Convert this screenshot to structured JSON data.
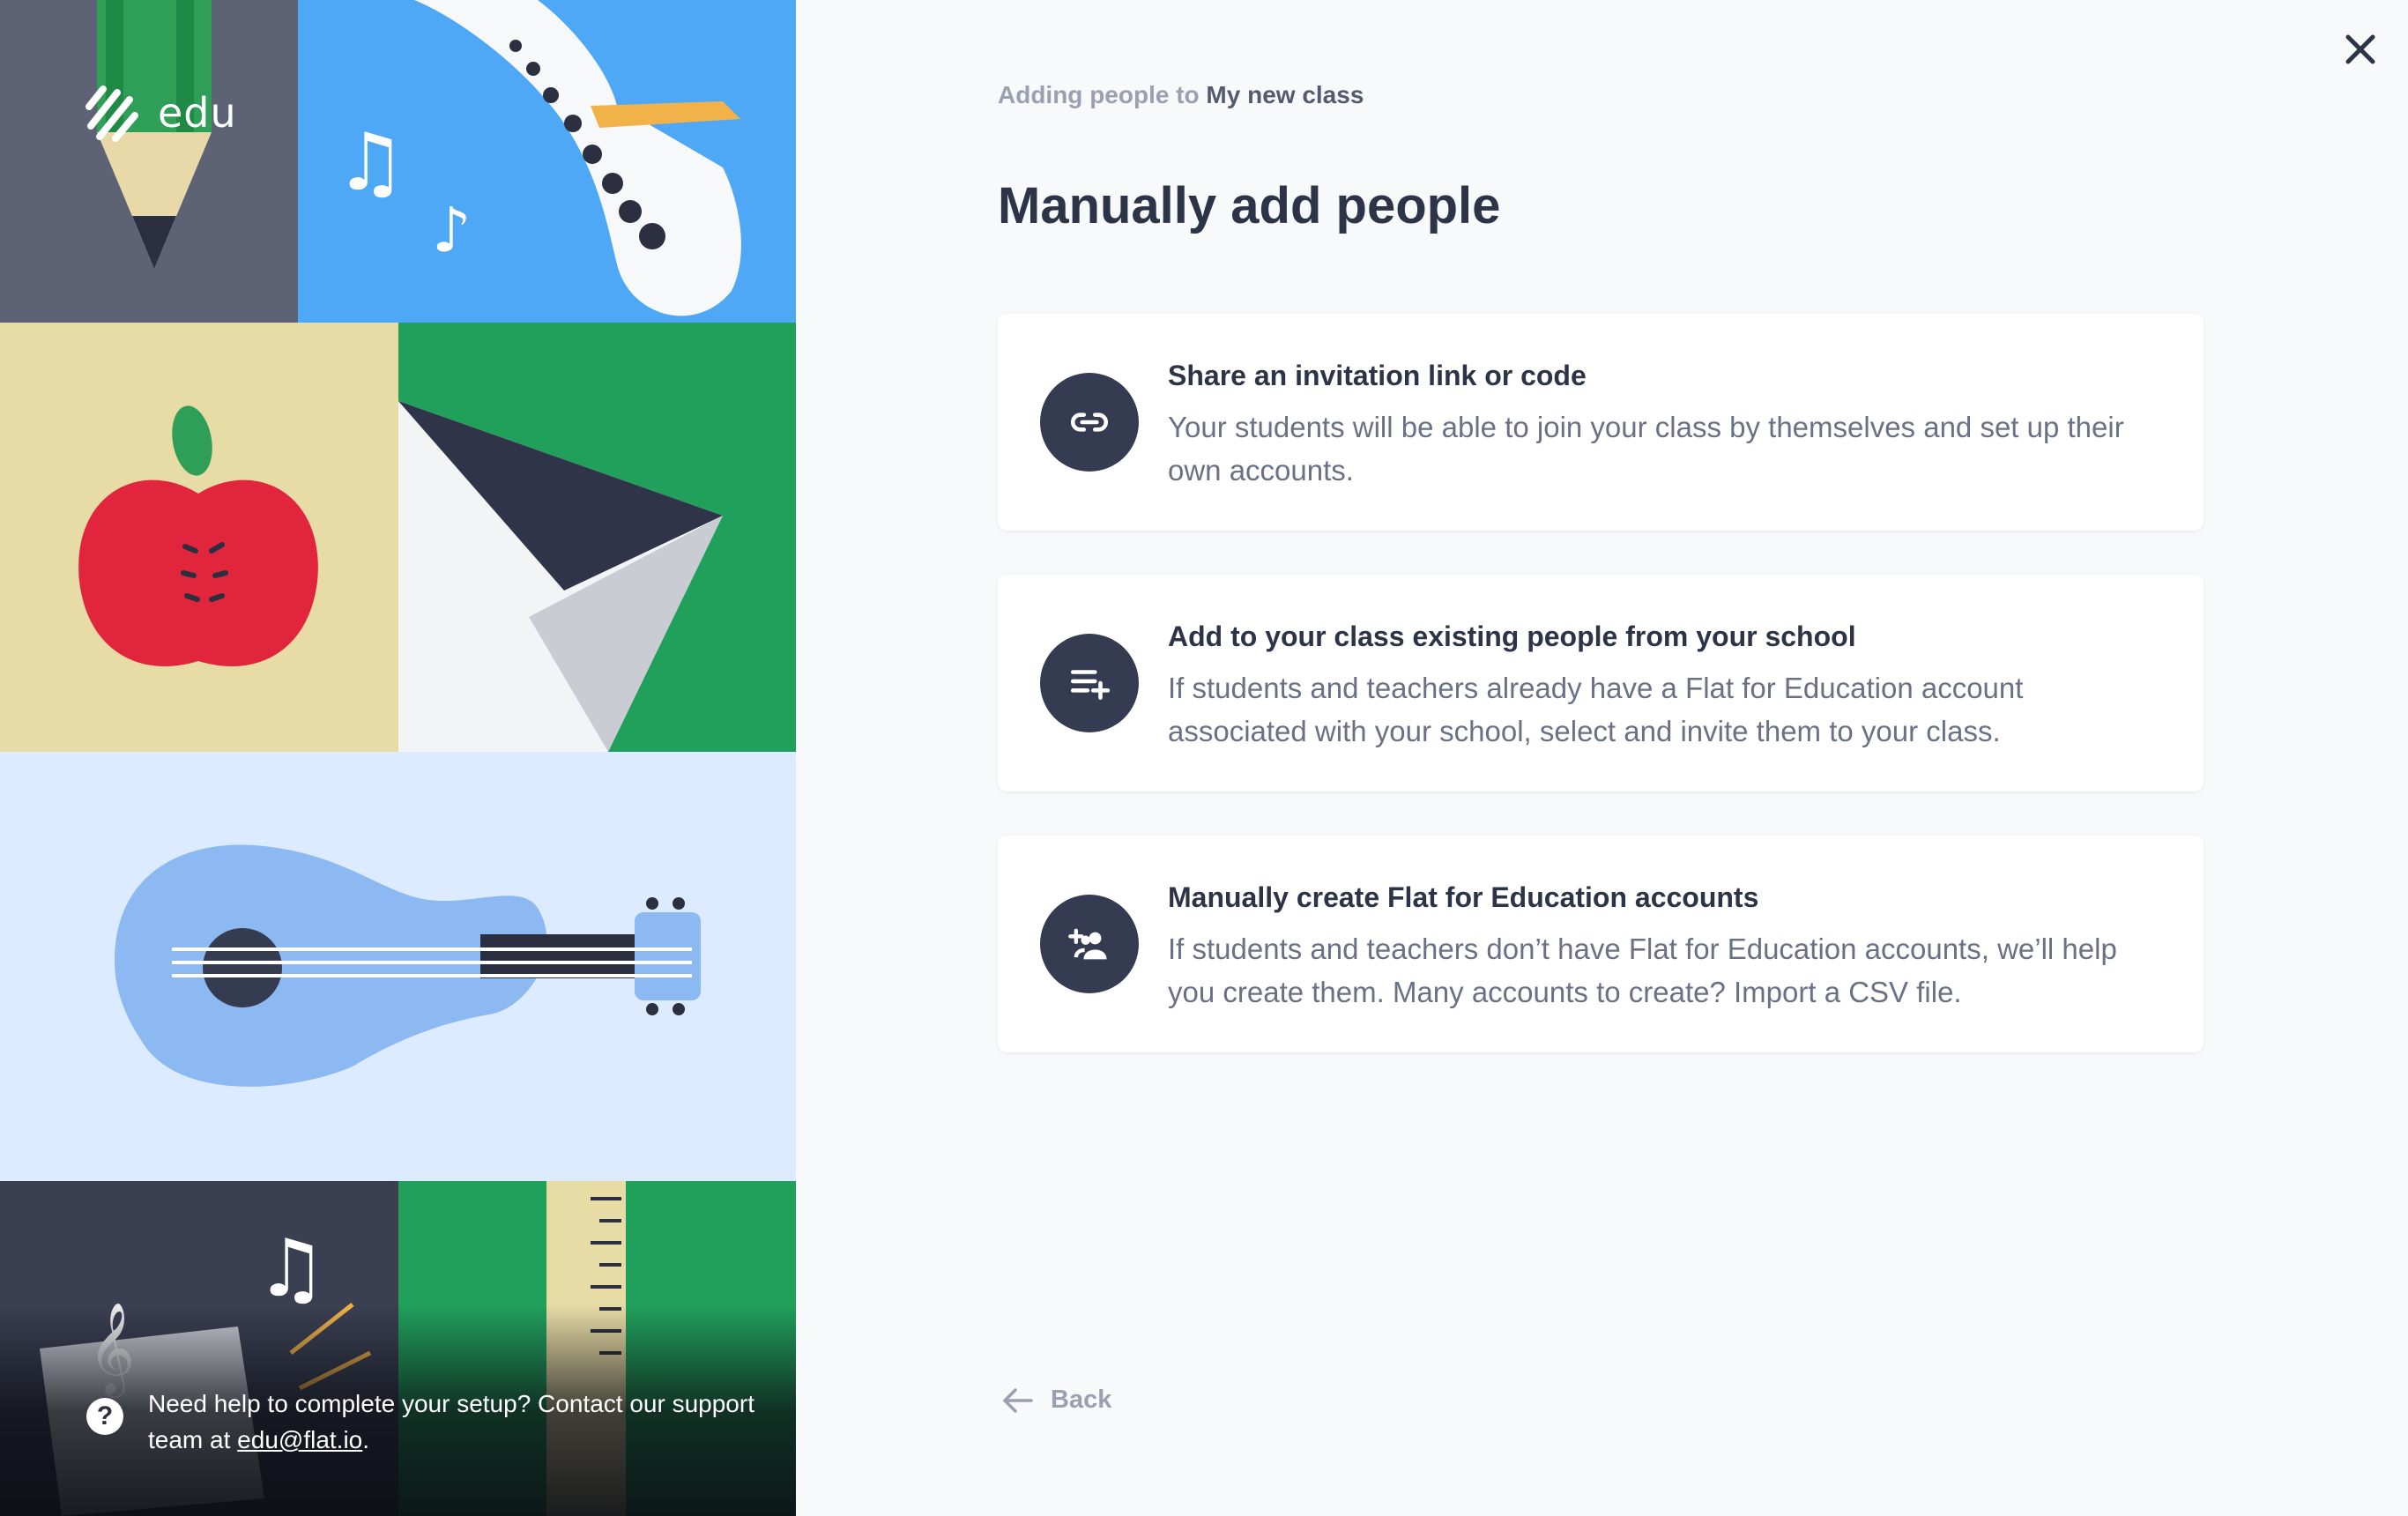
{
  "logo": {
    "text": "edu"
  },
  "help": {
    "text": "Need help to complete your setup? Contact our support team at ",
    "email": "edu@flat.io",
    "suffix": "."
  },
  "breadcrumb": {
    "prefix": "Adding people to",
    "class_name": "My new class"
  },
  "title": "Manually add people",
  "options": [
    {
      "title": "Share an invitation link or code",
      "description": "Your students will be able to join your class by themselves and set up their own accounts.",
      "icon": "link-icon"
    },
    {
      "title": "Add to your class existing people from your school",
      "description": "If students and teachers already have a Flat for Education account associated with your school, select and invite them to your class.",
      "icon": "playlist-add-icon"
    },
    {
      "title": "Manually create Flat for Education accounts",
      "description": "If students and teachers don’t have Flat for Education accounts, we’ll help you create them. Many accounts to create? Import a CSV file.",
      "icon": "group-add-icon"
    }
  ],
  "back_label": "Back",
  "colors": {
    "accent_dark": "#353b51",
    "background": "#f8f9fb",
    "muted_text": "#9aa0b0"
  }
}
